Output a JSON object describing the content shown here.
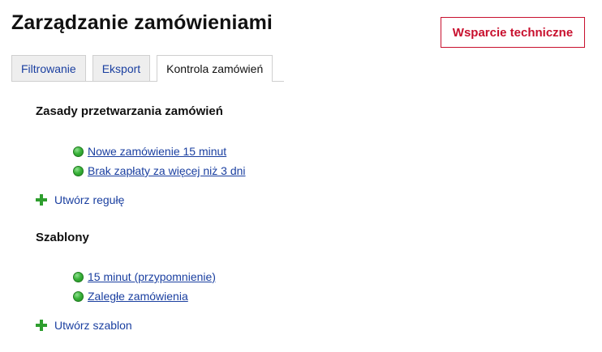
{
  "header": {
    "title": "Zarządzanie zamówieniami",
    "support_label": "Wsparcie techniczne"
  },
  "tabs": [
    {
      "label": "Filtrowanie",
      "active": false
    },
    {
      "label": "Eksport",
      "active": false
    },
    {
      "label": "Kontrola zamówień",
      "active": true
    }
  ],
  "rules": {
    "title": "Zasady przetwarzania zamówień",
    "items": [
      {
        "label": "Nowe zamówienie 15 minut",
        "status": "green-dot-icon"
      },
      {
        "label": "Brak zapłaty za więcej niż 3 dni",
        "status": "green-dot-icon"
      }
    ],
    "add_label": "Utwórz regułę"
  },
  "templates": {
    "title": "Szablony",
    "items": [
      {
        "label": "15 minut (przypomnienie)",
        "status": "green-dot-icon"
      },
      {
        "label": "Zaległe zamówienia",
        "status": "green-dot-icon"
      }
    ],
    "add_label": "Utwórz szablon"
  },
  "colors": {
    "accent_red": "#c8102e",
    "link_blue": "#1a3fa0",
    "status_green": "#3bb33b",
    "plus_green": "#2e9e2e"
  }
}
